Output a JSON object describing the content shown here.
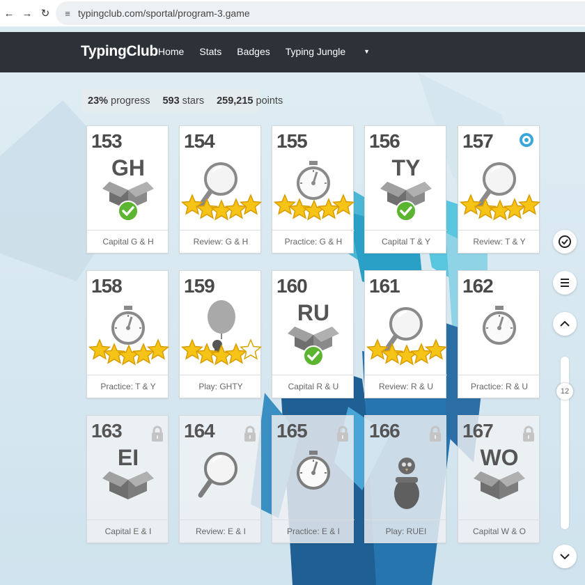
{
  "browser": {
    "url": "typingclub.com/sportal/program-3.game"
  },
  "header": {
    "logo": "TypingClub",
    "menu": [
      {
        "label": "Home"
      },
      {
        "label": "Stats"
      },
      {
        "label": "Badges"
      },
      {
        "label": "Typing Jungle"
      }
    ]
  },
  "progress": {
    "percent_value": "23%",
    "percent_label": "progress",
    "stars_value": "593",
    "stars_label": "stars",
    "points_value": "259,215",
    "points_label": "points"
  },
  "lessons": [
    {
      "number": "153",
      "letters": "GH",
      "caption": "Capital G & H",
      "icon": "box-check-icon",
      "stars": 0,
      "locked": false
    },
    {
      "number": "154",
      "letters": "",
      "caption": "Review: G & H",
      "icon": "magnifier-icon",
      "stars": 5,
      "locked": false
    },
    {
      "number": "155",
      "letters": "",
      "caption": "Practice: G & H",
      "icon": "stopwatch-icon",
      "stars": 5,
      "locked": false
    },
    {
      "number": "156",
      "letters": "TY",
      "caption": "Capital T & Y",
      "icon": "box-check-icon",
      "stars": 0,
      "locked": false
    },
    {
      "number": "157",
      "letters": "",
      "caption": "Review: T & Y",
      "icon": "magnifier-icon",
      "stars": 5,
      "locked": false,
      "badge": "award-badge-icon"
    },
    {
      "number": "158",
      "letters": "",
      "caption": "Practice: T & Y",
      "icon": "stopwatch-icon",
      "stars": 5,
      "locked": false
    },
    {
      "number": "159",
      "letters": "",
      "caption": "Play: GHTY",
      "icon": "balloon-game-icon",
      "stars": 4,
      "locked": false
    },
    {
      "number": "160",
      "letters": "RU",
      "caption": "Capital R & U",
      "icon": "box-check-icon",
      "stars": 0,
      "locked": false
    },
    {
      "number": "161",
      "letters": "",
      "caption": "Review: R & U",
      "icon": "magnifier-icon",
      "stars": 5,
      "locked": false
    },
    {
      "number": "162",
      "letters": "",
      "caption": "Practice: R & U",
      "icon": "stopwatch-icon",
      "stars": 0,
      "locked": false
    },
    {
      "number": "163",
      "letters": "EI",
      "caption": "Capital E & I",
      "icon": "box-icon",
      "stars": 0,
      "locked": true
    },
    {
      "number": "164",
      "letters": "",
      "caption": "Review: E & I",
      "icon": "magnifier-icon",
      "stars": 0,
      "locked": true
    },
    {
      "number": "165",
      "letters": "",
      "caption": "Practice: E & I",
      "icon": "stopwatch-icon",
      "stars": 0,
      "locked": true
    },
    {
      "number": "166",
      "letters": "",
      "caption": "Play: RUEI",
      "icon": "penguin-jar-game-icon",
      "stars": 0,
      "locked": true
    },
    {
      "number": "167",
      "letters": "WO",
      "caption": "Capital W & O",
      "icon": "box-icon",
      "stars": 0,
      "locked": true
    }
  ],
  "rail": {
    "check_icon": "check-circle-icon",
    "menu_icon": "list-menu-icon",
    "up_icon": "chevron-up-icon",
    "down_icon": "chevron-down-icon",
    "slider_value": "12"
  },
  "colors": {
    "header_bg": "#2c3237",
    "star": "#f6c416",
    "check": "#5cb531",
    "icon_gray": "#8a8a8a"
  }
}
